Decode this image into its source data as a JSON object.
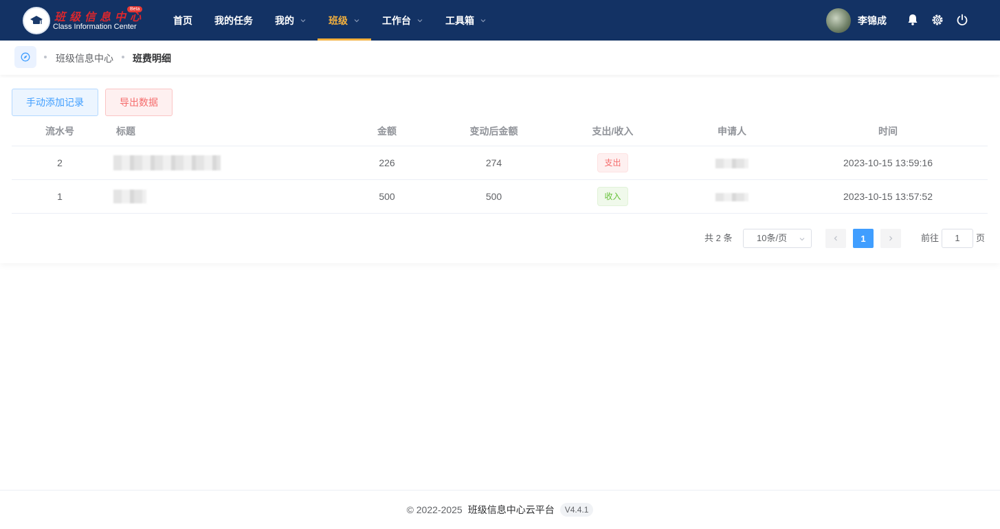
{
  "brand": {
    "title": "班级信息中心",
    "subtitle": "Class Information Center",
    "badge": "Beta"
  },
  "nav": [
    {
      "label": "首页",
      "has_dropdown": false,
      "active": false
    },
    {
      "label": "我的任务",
      "has_dropdown": false,
      "active": false
    },
    {
      "label": "我的",
      "has_dropdown": true,
      "active": false
    },
    {
      "label": "班级",
      "has_dropdown": true,
      "active": true
    },
    {
      "label": "工作台",
      "has_dropdown": true,
      "active": false
    },
    {
      "label": "工具箱",
      "has_dropdown": true,
      "active": false
    }
  ],
  "user": {
    "name": "李锦成"
  },
  "header_icons": [
    "bell-icon",
    "gear-icon",
    "power-icon"
  ],
  "breadcrumb": {
    "home_icon": "compass-icon",
    "items": [
      "班级信息中心",
      "班费明细"
    ]
  },
  "actions": {
    "add_label": "手动添加记录",
    "export_label": "导出数据"
  },
  "table": {
    "columns": [
      "流水号",
      "标题",
      "金额",
      "变动后金额",
      "支出/收入",
      "申请人",
      "时间"
    ],
    "rows": [
      {
        "no": "2",
        "title": "",
        "amount": "226",
        "after": "274",
        "type": "支出",
        "type_kind": "out",
        "applicant": "",
        "time": "2023-10-15 13:59:16"
      },
      {
        "no": "1",
        "title": "",
        "amount": "500",
        "after": "500",
        "type": "收入",
        "type_kind": "in",
        "applicant": "",
        "time": "2023-10-15 13:57:52"
      }
    ]
  },
  "pagination": {
    "total_text": "共 2 条",
    "page_size": "10条/页",
    "current_page": "1",
    "goto_label": "前往",
    "goto_value": "1",
    "page_suffix": "页"
  },
  "footer": {
    "copyright": "© 2022-2025",
    "platform": "班级信息中心云平台",
    "version": "V4.4.1"
  },
  "colors": {
    "header_bg": "#133264",
    "active_nav": "#f5b13d",
    "primary": "#409eff",
    "danger": "#f56c6c",
    "success": "#67c23a"
  }
}
